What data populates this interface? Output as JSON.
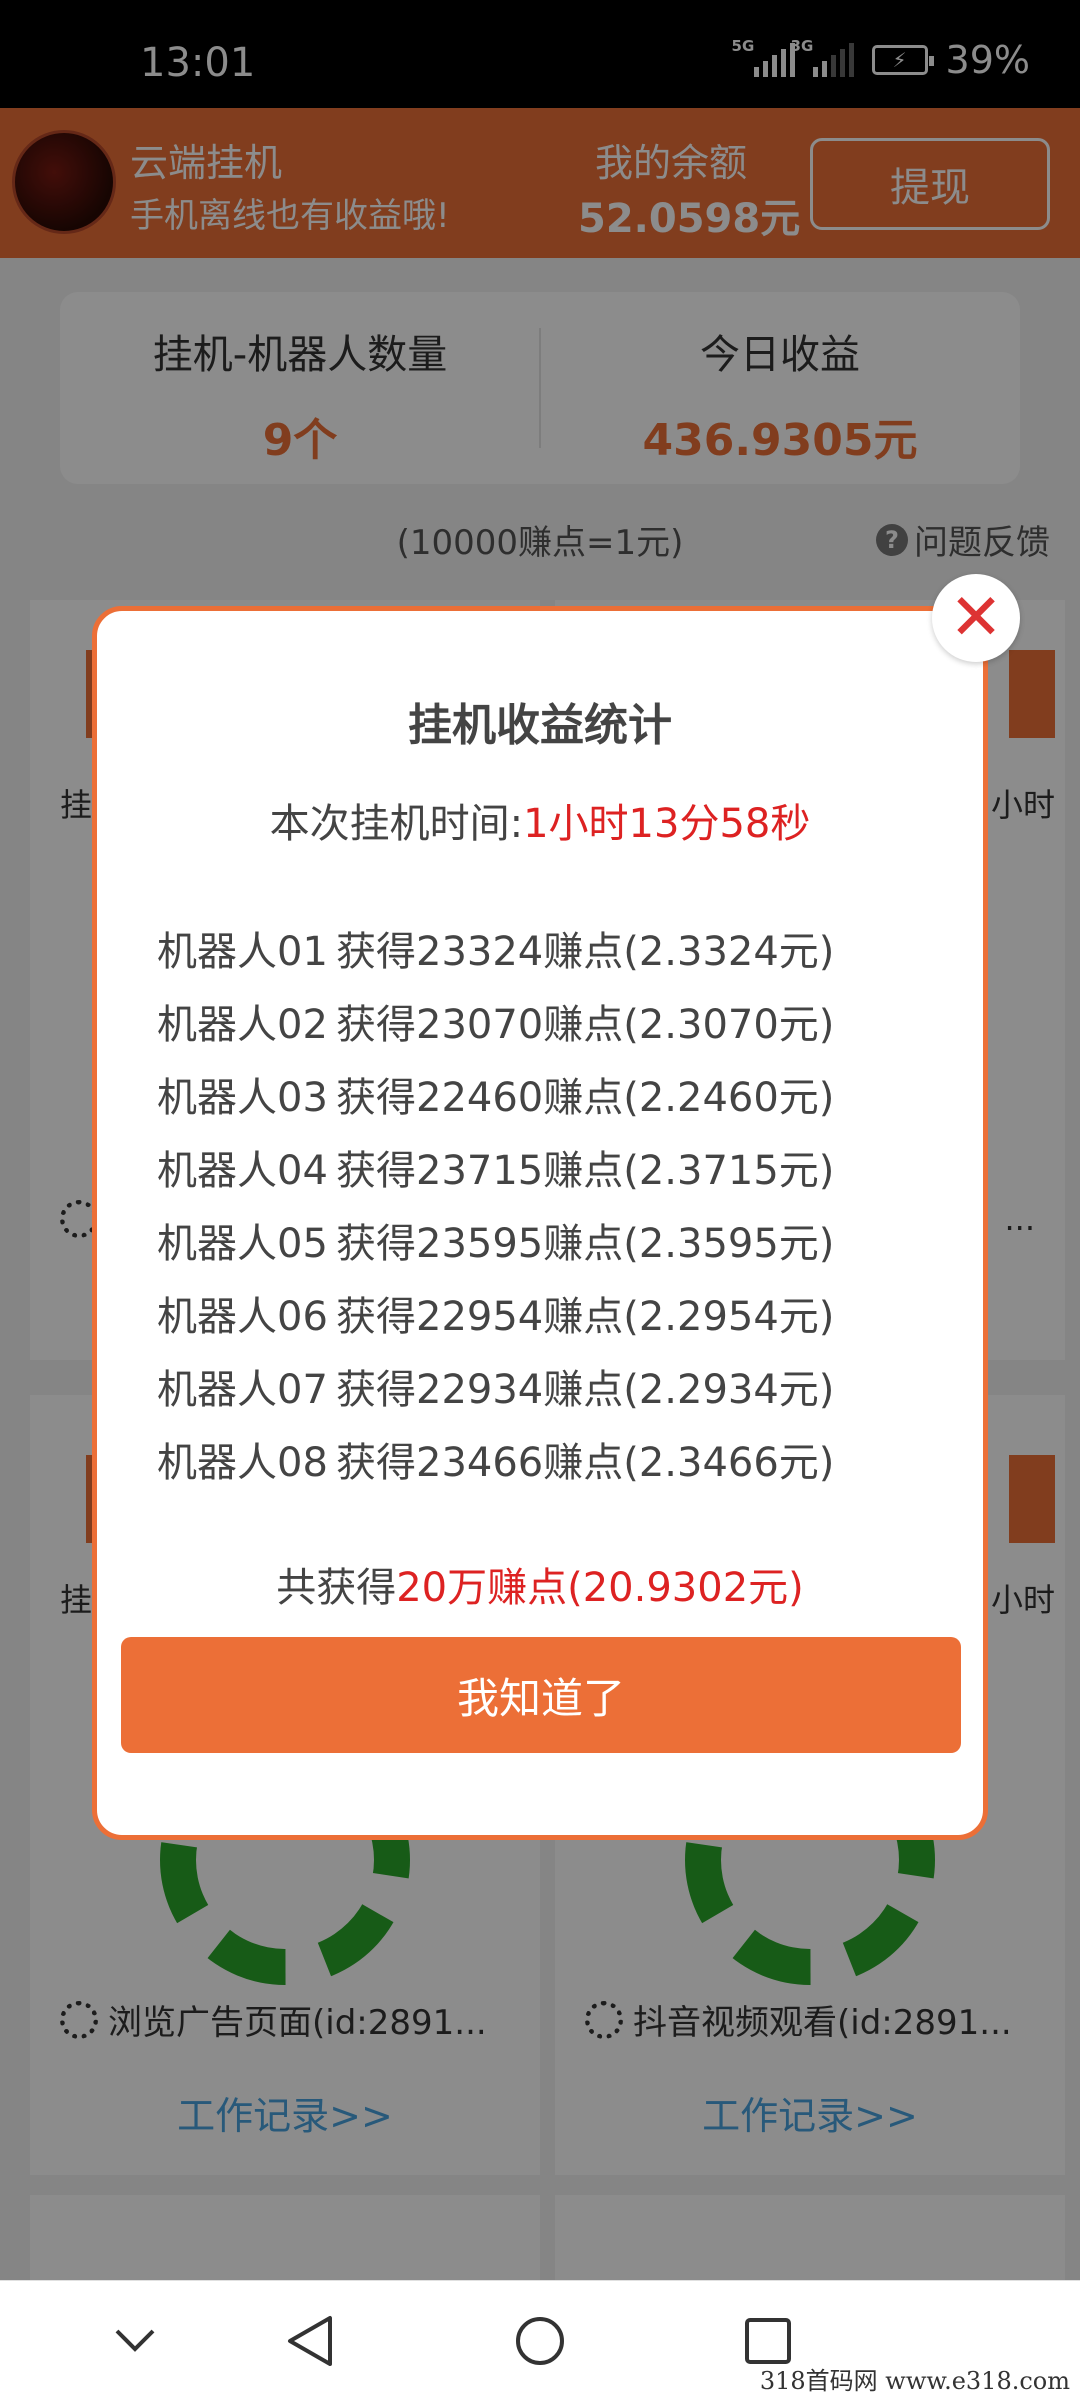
{
  "status_bar": {
    "time": "13:01",
    "net1": "5G",
    "net2": "3G",
    "battery": "39%"
  },
  "header": {
    "app_name": "云端挂机",
    "slogan": "手机离线也有收益哦!",
    "balance_label": "我的余额",
    "balance_value": "52.0598元",
    "withdraw_label": "提现"
  },
  "stats": {
    "robots_label": "挂机-机器人数量",
    "robots_value": "9个",
    "today_label": "今日收益",
    "today_value": "436.9305元"
  },
  "rate_text": "(10000赚点=1元)",
  "feedback_label": "问题反馈",
  "bg_cards": {
    "left_partial": "挂",
    "right_partial": "小时",
    "left_task": "浏览广告页面(id:2891...",
    "right_task": "抖音视频观看(id:2891...",
    "log_label": "工作记录>>",
    "ellipsis": "..."
  },
  "modal": {
    "title": "挂机收益统计",
    "time_label": "本次挂机时间:",
    "time_value": "1小时13分58秒",
    "rows": [
      {
        "name": "机器人01",
        "earn": "获得23324赚点(2.3324元)"
      },
      {
        "name": "机器人02",
        "earn": "获得23070赚点(2.3070元)"
      },
      {
        "name": "机器人03",
        "earn": "获得22460赚点(2.2460元)"
      },
      {
        "name": "机器人04",
        "earn": "获得23715赚点(2.3715元)"
      },
      {
        "name": "机器人05",
        "earn": "获得23595赚点(2.3595元)"
      },
      {
        "name": "机器人06",
        "earn": "获得22954赚点(2.2954元)"
      },
      {
        "name": "机器人07",
        "earn": "获得22934赚点(2.2934元)"
      },
      {
        "name": "机器人08",
        "earn": "获得23466赚点(2.3466元)"
      }
    ],
    "total_prefix": "共获得",
    "total_value": "20万赚点(20.9302元)",
    "ok_label": "我知道了",
    "close_glyph": "✕"
  },
  "watermark": "318首码网  www.e318.com"
}
